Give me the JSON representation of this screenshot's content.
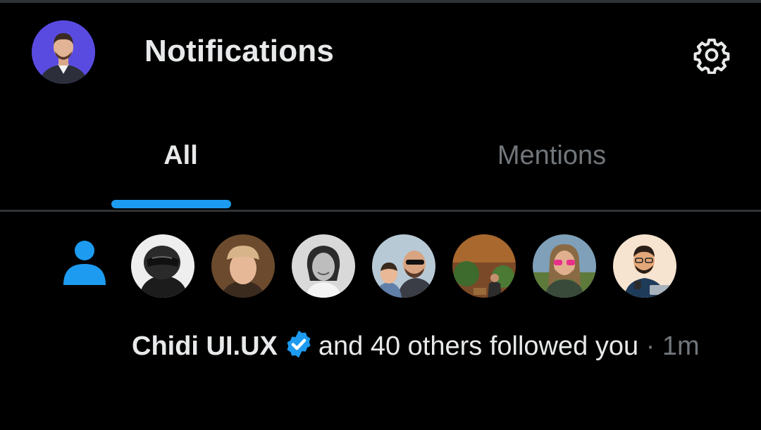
{
  "header": {
    "title": "Notifications",
    "avatar_icon": "user-avatar",
    "settings_icon": "gear-icon"
  },
  "tabs": [
    {
      "label": "All",
      "active": true
    },
    {
      "label": "Mentions",
      "active": false
    }
  ],
  "notification": {
    "icon": "person-icon",
    "actor_name": "Chidi UI.UX",
    "verified": true,
    "action_text": "and 40 others followed you",
    "separator": "·",
    "time": "1m",
    "follower_avatars": [
      "helmet-rider-avatar",
      "cap-wearer-avatar",
      "smiling-woman-avatar",
      "father-and-child-avatar",
      "man-in-garden-avatar",
      "pink-sunglasses-avatar",
      "cartoon-man-avatar"
    ]
  },
  "colors": {
    "background": "#000000",
    "text_primary": "#e7e9ea",
    "text_secondary": "#71767b",
    "accent": "#1d9bf0",
    "divider": "#2f3336"
  }
}
